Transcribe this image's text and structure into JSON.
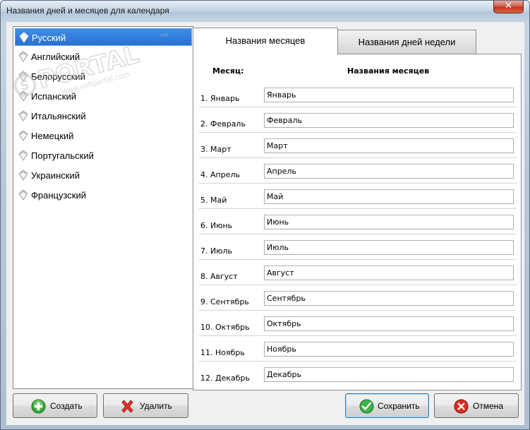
{
  "window": {
    "title": "Названия дней и месяцев для календаря",
    "close_glyph": "✕"
  },
  "watermark": {
    "brand": "PORTAL",
    "prefix": "S",
    "domain": "www.softportal.com",
    "trademark": "TM"
  },
  "languages": [
    {
      "label": "Русский",
      "selected": true
    },
    {
      "label": "Английский",
      "selected": false
    },
    {
      "label": "Белорусский",
      "selected": false
    },
    {
      "label": "Испанский",
      "selected": false
    },
    {
      "label": "Итальянский",
      "selected": false
    },
    {
      "label": "Немецкий",
      "selected": false
    },
    {
      "label": "Португальский",
      "selected": false
    },
    {
      "label": "Украинский",
      "selected": false
    },
    {
      "label": "Французский",
      "selected": false
    }
  ],
  "tabs": [
    {
      "label": "Названия месяцев",
      "active": true
    },
    {
      "label": "Названия дней недели",
      "active": false
    }
  ],
  "table": {
    "headers": {
      "month": "Месяц:",
      "names": "Названия месяцев"
    },
    "rows": [
      {
        "label": "1. Январь",
        "value": "Январь"
      },
      {
        "label": "2. Февраль",
        "value": "Февраль"
      },
      {
        "label": "3. Март",
        "value": "Март"
      },
      {
        "label": "4. Апрель",
        "value": "Апрель"
      },
      {
        "label": "5. Май",
        "value": "Май"
      },
      {
        "label": "6. Июнь",
        "value": "Июнь"
      },
      {
        "label": "7. Июль",
        "value": "Июль"
      },
      {
        "label": "8. Август",
        "value": "Август"
      },
      {
        "label": "9. Сентябрь",
        "value": "Сентябрь"
      },
      {
        "label": "10. Октябрь",
        "value": "Октябрь"
      },
      {
        "label": "11. Ноябрь",
        "value": "Ноябрь"
      },
      {
        "label": "12. Декабрь",
        "value": "Декабрь"
      }
    ]
  },
  "buttons": {
    "create": "Создать",
    "delete": "Удалить",
    "save": "Сохранить",
    "cancel": "Отмена"
  },
  "icons": {
    "language": "page-icon",
    "create": "plus-icon",
    "delete": "cross-icon",
    "save": "check-icon",
    "cancel": "cancel-icon"
  },
  "colors": {
    "selection": "#2a6fd1",
    "create": "#3aa836",
    "delete": "#e0332a",
    "save": "#3fb24a",
    "cancel": "#d92b20"
  }
}
